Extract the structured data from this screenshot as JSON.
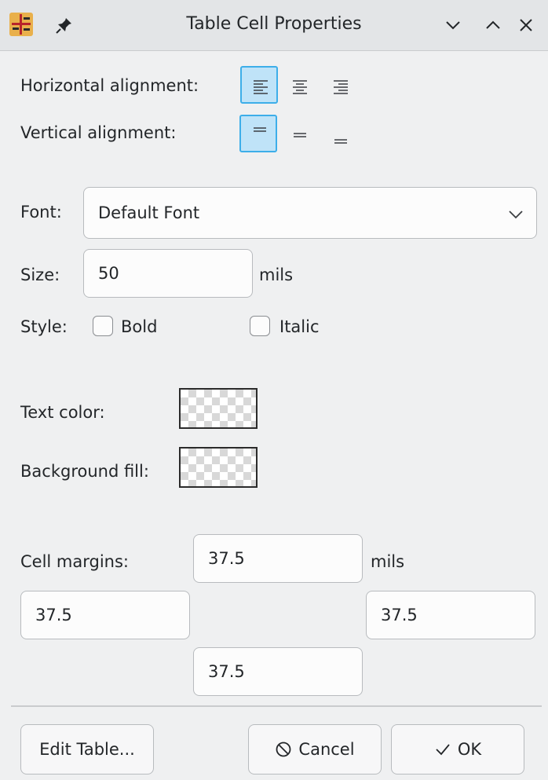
{
  "window": {
    "title": "Table Cell Properties",
    "app_icon": "kicad-pcb-editor-icon",
    "pin_icon": "pin-icon",
    "controls": [
      "chevron-down-icon",
      "chevron-up-icon",
      "close-icon"
    ]
  },
  "alignment": {
    "horizontal_label": "Horizontal alignment:",
    "vertical_label": "Vertical alignment:",
    "horizontal_selected": "left",
    "vertical_selected": "top"
  },
  "font": {
    "label": "Font:",
    "value": "Default Font"
  },
  "size": {
    "label": "Size:",
    "value": "50",
    "unit": "mils"
  },
  "style": {
    "label": "Style:",
    "bold_label": "Bold",
    "italic_label": "Italic",
    "bold_checked": false,
    "italic_checked": false
  },
  "colors": {
    "text_color_label": "Text color:",
    "background_fill_label": "Background fill:"
  },
  "margins": {
    "label": "Cell margins:",
    "unit": "mils",
    "top": "37.5",
    "left": "37.5",
    "right": "37.5",
    "bottom": "37.5"
  },
  "buttons": {
    "edit_table": "Edit Table...",
    "cancel": "Cancel",
    "ok": "OK"
  },
  "theme": {
    "accent": "#3daee9",
    "accent_fill": "#bfe3f8",
    "background": "#eff0f1"
  }
}
